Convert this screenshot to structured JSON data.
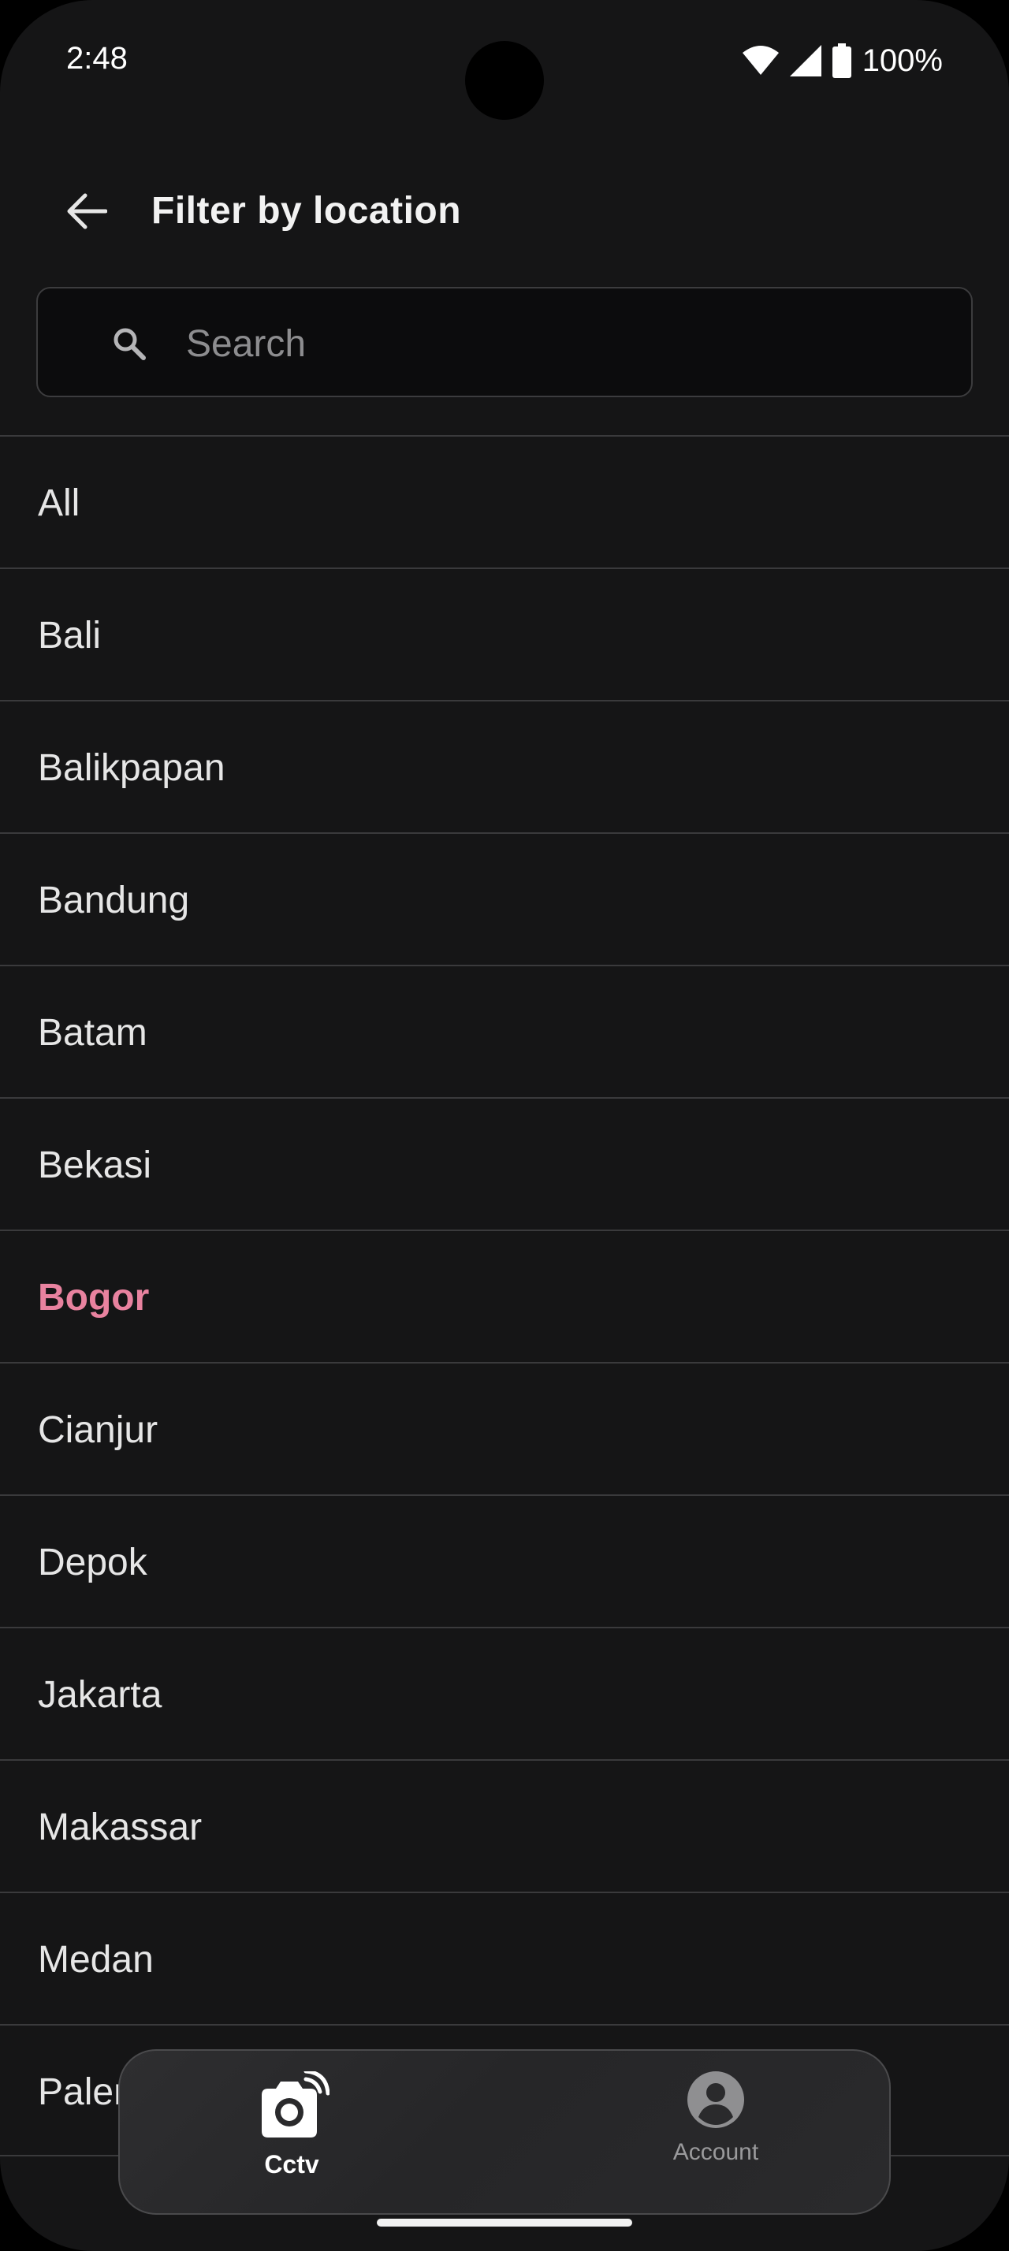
{
  "status_bar": {
    "time": "2:48",
    "battery": "100%",
    "icons": [
      "wifi-icon",
      "signal-icon",
      "battery-icon"
    ]
  },
  "header": {
    "title": "Filter by location",
    "back_icon": "arrow-left-icon"
  },
  "search": {
    "placeholder": "Search",
    "value": "",
    "icon": "search-icon"
  },
  "locations": {
    "selected": "Bogor",
    "selected_color": "#e8829f",
    "items": [
      "All",
      "Bali",
      "Balikpapan",
      "Bandung",
      "Batam",
      "Bekasi",
      "Bogor",
      "Cianjur",
      "Depok",
      "Jakarta",
      "Makassar",
      "Medan",
      "Palembang"
    ]
  },
  "bottom_nav": {
    "items": [
      {
        "label": "Cctv",
        "icon": "cctv-camera-icon",
        "active": true
      },
      {
        "label": "Account",
        "icon": "account-circle-icon",
        "active": false
      }
    ]
  }
}
